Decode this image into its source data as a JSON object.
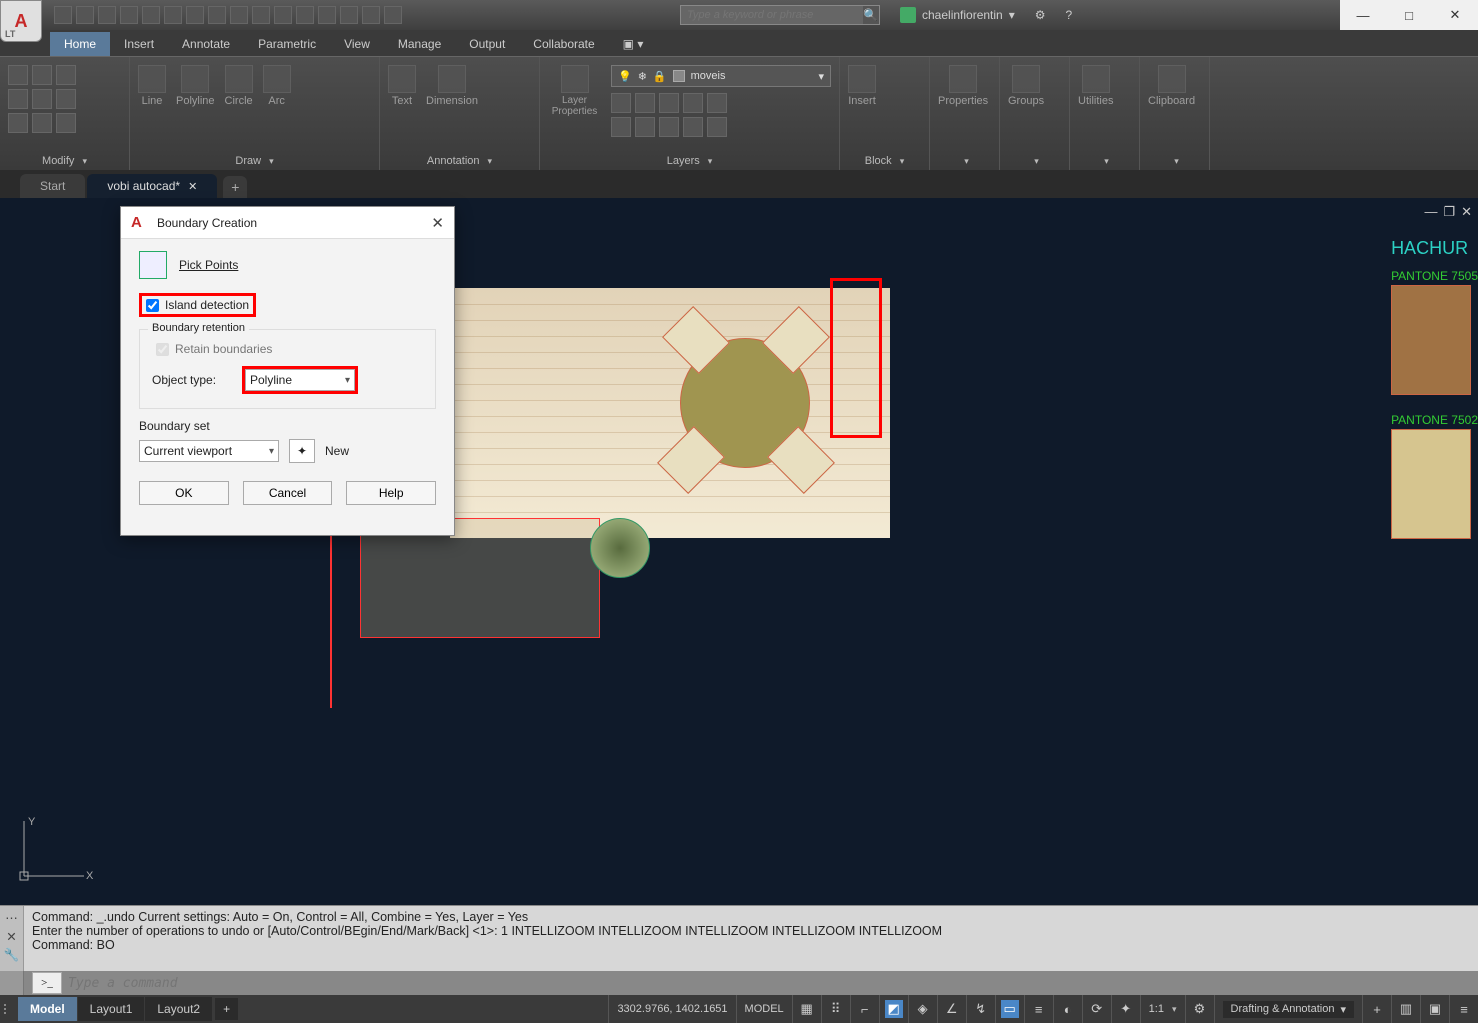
{
  "app": {
    "title": "vobi autocad.dwg",
    "search_placeholder": "Type a keyword or phrase",
    "user": "chaelinfiorentin"
  },
  "window_buttons": {
    "min": "—",
    "max": "□",
    "close": "✕"
  },
  "ribbon_tabs": [
    "Home",
    "Insert",
    "Annotate",
    "Parametric",
    "View",
    "Manage",
    "Output",
    "Collaborate"
  ],
  "active_ribbon_tab": "Home",
  "ribbon": {
    "modify": {
      "title": "Modify"
    },
    "draw": {
      "title": "Draw",
      "items": [
        "Line",
        "Polyline",
        "Circle",
        "Arc"
      ]
    },
    "annotation": {
      "title": "Annotation",
      "items": [
        "Text",
        "Dimension"
      ]
    },
    "layers": {
      "title": "Layers",
      "combo_label": "moveis",
      "props": "Layer Properties"
    },
    "block": {
      "title": "Block",
      "insert": "Insert"
    },
    "properties": {
      "title": "Properties"
    },
    "groups": {
      "title": "Groups"
    },
    "utilities": {
      "title": "Utilities"
    },
    "clipboard": {
      "title": "Clipboard"
    }
  },
  "filetabs": {
    "start": "Start",
    "active": "vobi autocad*"
  },
  "legend": {
    "title": "HACHUR",
    "swatch1_label": "PANTONE 7505",
    "swatch1_color": "#a07244",
    "swatch2_label": "PANTONE 7502",
    "swatch2_color": "#d6c58f"
  },
  "dialog": {
    "title": "Boundary Creation",
    "pick_points": "Pick Points",
    "island_detection": "Island detection",
    "island_checked": true,
    "group_boundary_retention": "Boundary retention",
    "retain_boundaries": "Retain boundaries",
    "retain_checked": true,
    "object_type_label": "Object type:",
    "object_type_value": "Polyline",
    "boundary_set_label": "Boundary set",
    "boundary_set_value": "Current viewport",
    "new_label": "New",
    "ok": "OK",
    "cancel": "Cancel",
    "help": "Help"
  },
  "command": {
    "line1": "Command: _.undo Current settings: Auto = On, Control = All, Combine = Yes, Layer = Yes",
    "line2": "Enter the number of operations to undo or [Auto/Control/BEgin/End/Mark/Back] <1>: 1 INTELLIZOOM INTELLIZOOM INTELLIZOOM INTELLIZOOM INTELLIZOOM",
    "line3": "Command: BO",
    "placeholder": "Type a command",
    "prompt": ">_"
  },
  "bottom": {
    "tabs": [
      "Model",
      "Layout1",
      "Layout2"
    ],
    "active": "Model",
    "coords": "3302.9766, 1402.1651",
    "space": "MODEL",
    "scale": "1:1",
    "workspace": "Drafting & Annotation"
  }
}
